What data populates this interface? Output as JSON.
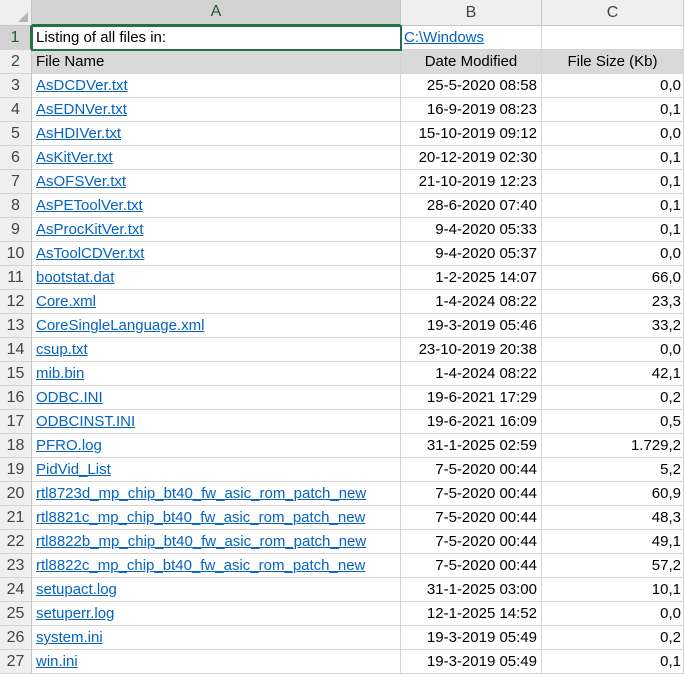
{
  "columns": [
    "A",
    "B",
    "C"
  ],
  "title_row": {
    "label": "Listing of all files in:",
    "folder": "C:\\Windows"
  },
  "header_row": {
    "name": "File Name",
    "modified": "Date Modified",
    "size": "File Size (Kb)"
  },
  "rows": [
    {
      "n": "3",
      "name": "AsDCDVer.txt",
      "date": "25-5-2020 08:58",
      "size": "0,0"
    },
    {
      "n": "4",
      "name": "AsEDNVer.txt",
      "date": "16-9-2019 08:23",
      "size": "0,1"
    },
    {
      "n": "5",
      "name": "AsHDIVer.txt",
      "date": "15-10-2019 09:12",
      "size": "0,0"
    },
    {
      "n": "6",
      "name": "AsKitVer.txt",
      "date": "20-12-2019 02:30",
      "size": "0,1"
    },
    {
      "n": "7",
      "name": "AsOFSVer.txt",
      "date": "21-10-2019 12:23",
      "size": "0,1"
    },
    {
      "n": "8",
      "name": "AsPEToolVer.txt",
      "date": "28-6-2020 07:40",
      "size": "0,1"
    },
    {
      "n": "9",
      "name": "AsProcKitVer.txt",
      "date": "9-4-2020 05:33",
      "size": "0,1"
    },
    {
      "n": "10",
      "name": "AsToolCDVer.txt",
      "date": "9-4-2020 05:37",
      "size": "0,0"
    },
    {
      "n": "11",
      "name": "bootstat.dat",
      "date": "1-2-2025 14:07",
      "size": "66,0"
    },
    {
      "n": "12",
      "name": "Core.xml",
      "date": "1-4-2024 08:22",
      "size": "23,3"
    },
    {
      "n": "13",
      "name": "CoreSingleLanguage.xml",
      "date": "19-3-2019 05:46",
      "size": "33,2"
    },
    {
      "n": "14",
      "name": "csup.txt",
      "date": "23-10-2019 20:38",
      "size": "0,0"
    },
    {
      "n": "15",
      "name": "mib.bin",
      "date": "1-4-2024 08:22",
      "size": "42,1"
    },
    {
      "n": "16",
      "name": "ODBC.INI",
      "date": "19-6-2021 17:29",
      "size": "0,2"
    },
    {
      "n": "17",
      "name": "ODBCINST.INI",
      "date": "19-6-2021 16:09",
      "size": "0,5"
    },
    {
      "n": "18",
      "name": "PFRO.log",
      "date": "31-1-2025 02:59",
      "size": "1.729,2"
    },
    {
      "n": "19",
      "name": "PidVid_List",
      "date": "7-5-2020 00:44",
      "size": "5,2"
    },
    {
      "n": "20",
      "name": "rtl8723d_mp_chip_bt40_fw_asic_rom_patch_new",
      "date": "7-5-2020 00:44",
      "size": "60,9"
    },
    {
      "n": "21",
      "name": "rtl8821c_mp_chip_bt40_fw_asic_rom_patch_new",
      "date": "7-5-2020 00:44",
      "size": "48,3"
    },
    {
      "n": "22",
      "name": "rtl8822b_mp_chip_bt40_fw_asic_rom_patch_new",
      "date": "7-5-2020 00:44",
      "size": "49,1"
    },
    {
      "n": "23",
      "name": "rtl8822c_mp_chip_bt40_fw_asic_rom_patch_new",
      "date": "7-5-2020 00:44",
      "size": "57,2"
    },
    {
      "n": "24",
      "name": "setupact.log",
      "date": "31-1-2025 03:00",
      "size": "10,1"
    },
    {
      "n": "25",
      "name": "setuperr.log",
      "date": "12-1-2025 14:52",
      "size": "0,0"
    },
    {
      "n": "26",
      "name": "system.ini",
      "date": "19-3-2019 05:49",
      "size": "0,2"
    },
    {
      "n": "27",
      "name": "win.ini",
      "date": "19-3-2019 05:49",
      "size": "0,1"
    }
  ]
}
